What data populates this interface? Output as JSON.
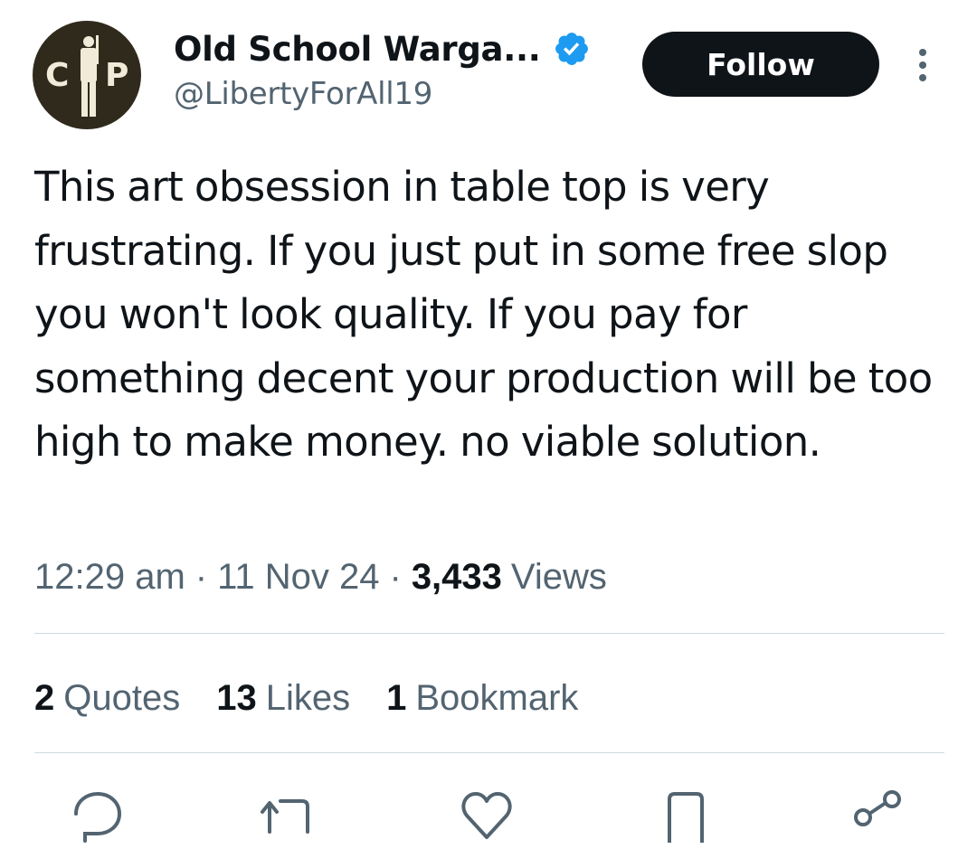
{
  "author": {
    "display_name": "Old School Warga...",
    "handle": "@LibertyForAll19",
    "avatar_letters": [
      "C",
      "P"
    ]
  },
  "follow_label": "Follow",
  "tweet": {
    "text": "This art obsession in table top is very frustrating. If you just put in some free slop you won't look quality. If you pay for something decent your production will be too high to make money. no viable solution."
  },
  "meta": {
    "time": "12:29 am",
    "separator": "·",
    "date": "11 Nov 24",
    "views_count": "3,433",
    "views_label": "Views"
  },
  "stats": {
    "quotes_count": "2",
    "quotes_label": "Quotes",
    "likes_count": "13",
    "likes_label": "Likes",
    "bookmarks_count": "1",
    "bookmarks_label": "Bookmark"
  },
  "icons": {
    "verified": "verified-badge-icon",
    "more": "more-vertical-icon",
    "reply": "reply-icon",
    "repost": "repost-icon",
    "like": "like-icon",
    "bookmark": "bookmark-icon",
    "share": "share-icon"
  },
  "colors": {
    "text_primary": "#0f1419",
    "text_secondary": "#536471",
    "verified_blue": "#1d9bf0",
    "follow_bg": "#0f1419",
    "divider": "#cfd9de"
  }
}
